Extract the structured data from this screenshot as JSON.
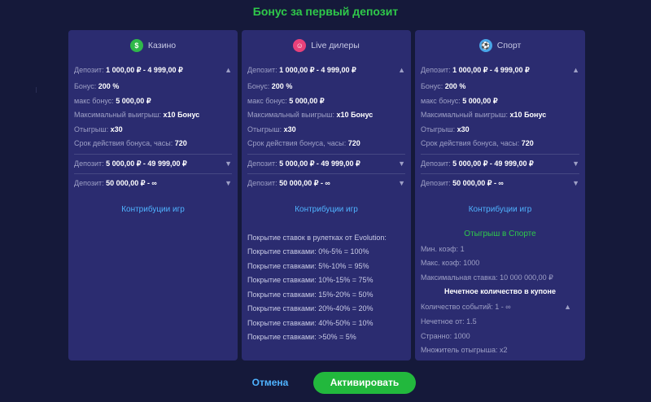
{
  "title": "Бонус за первый депозит",
  "colors": {
    "accent_green": "#2fc94a",
    "link_blue": "#4fb3ff",
    "panel": "#2b2c70",
    "background": "#15193a"
  },
  "columns": [
    {
      "icon": "casino-chip-icon",
      "name": "Казино",
      "tiers": [
        {
          "label": "Депозит:",
          "value": "1 000,00 ₽ - 4 999,00 ₽",
          "expanded": true
        },
        {
          "label": "Депозит:",
          "value": "5 000,00 ₽ - 49 999,00 ₽",
          "expanded": false
        },
        {
          "label": "Депозит:",
          "value": "50 000,00 ₽ - ∞",
          "expanded": false
        }
      ],
      "details": [
        {
          "label": "Бонус:",
          "value": "200 %"
        },
        {
          "label": "макс бонус:",
          "value": "5 000,00 ₽"
        },
        {
          "label": "Максимальный выигрыш:",
          "value": "x10 Бонус"
        },
        {
          "label": "Отыгрыш:",
          "value": "x30"
        },
        {
          "label": "Срок действия бонуса, часы:",
          "value": "720"
        }
      ],
      "link": "Контрибуции игр"
    },
    {
      "icon": "live-dealer-icon",
      "name": "Live дилеры",
      "tiers": [
        {
          "label": "Депозит:",
          "value": "1 000,00 ₽ - 4 999,00 ₽",
          "expanded": true
        },
        {
          "label": "Депозит:",
          "value": "5 000,00 ₽ - 49 999,00 ₽",
          "expanded": false
        },
        {
          "label": "Депозит:",
          "value": "50 000,00 ₽ - ∞",
          "expanded": false
        }
      ],
      "details": [
        {
          "label": "Бонус:",
          "value": "200 %"
        },
        {
          "label": "макс бонус:",
          "value": "5 000,00 ₽"
        },
        {
          "label": "Максимальный выигрыш:",
          "value": "x10 Бонус"
        },
        {
          "label": "Отыгрыш:",
          "value": "x30"
        },
        {
          "label": "Срок действия бонуса, часы:",
          "value": "720"
        }
      ],
      "link": "Контрибуции игр",
      "coverage_title": "Покрытие ставок в рулетках от Evolution:",
      "coverage": [
        "Покрытие ставками: 0%-5% = 100%",
        "Покрытие ставками: 5%-10% = 95%",
        "Покрытие ставками: 10%-15% = 75%",
        "Покрытие ставками: 15%-20% = 50%",
        "Покрытие ставками: 20%-40% = 20%",
        "Покрытие ставками: 40%-50% = 10%",
        "Покрытие ставками: >50% = 5%"
      ]
    },
    {
      "icon": "soccer-ball-icon",
      "name": "Спорт",
      "tiers": [
        {
          "label": "Депозит:",
          "value": "1 000,00 ₽ - 4 999,00 ₽",
          "expanded": true
        },
        {
          "label": "Депозит:",
          "value": "5 000,00 ₽ - 49 999,00 ₽",
          "expanded": false
        },
        {
          "label": "Депозит:",
          "value": "50 000,00 ₽ - ∞",
          "expanded": false
        }
      ],
      "details": [
        {
          "label": "Бонус:",
          "value": "200 %"
        },
        {
          "label": "макс бонус:",
          "value": "5 000,00 ₽"
        },
        {
          "label": "Максимальный выигрыш:",
          "value": "x10 Бонус"
        },
        {
          "label": "Отыгрыш:",
          "value": "x30"
        },
        {
          "label": "Срок действия бонуса, часы:",
          "value": "720"
        }
      ],
      "link": "Контрибуции игр",
      "sport_title": "Отыгрыш в Спорте",
      "sport_rows": [
        {
          "label": "Мин. коэф:",
          "value": "1"
        },
        {
          "label": "Макс. коэф:",
          "value": "1000"
        },
        {
          "label": "Максимальная ставка:",
          "value": "10 000 000,00 ₽"
        }
      ],
      "odd_title": "Нечетное количество в купоне",
      "odd_rows": [
        {
          "label": "Количество событий:",
          "value": "1 - ∞"
        },
        {
          "label": "Нечетное от:",
          "value": "1.5"
        },
        {
          "label": "Странно:",
          "value": "1000"
        },
        {
          "label": "Множитель отыгрыша:",
          "value": "x2"
        }
      ]
    }
  ],
  "buttons": {
    "cancel": "Отмена",
    "activate": "Активировать"
  }
}
